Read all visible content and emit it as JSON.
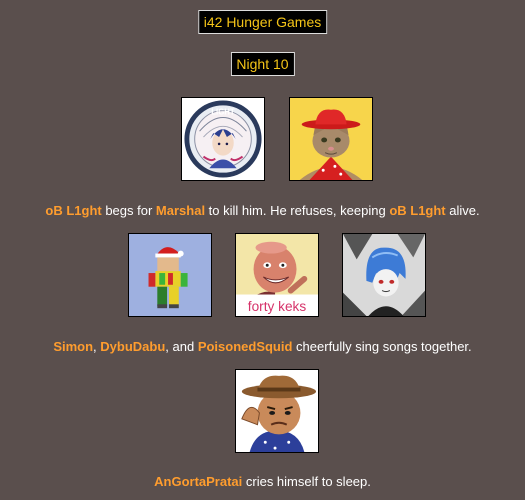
{
  "header": {
    "title": "i42 Hunger Games",
    "subtitle": "Night 10"
  },
  "colors": {
    "background": "#5a4f4d",
    "title_text": "#f5c518",
    "name_highlight": "#ff9d2e",
    "body_text": "#ffffff"
  },
  "events": [
    {
      "tributes": [
        "oB L1ght",
        "Marshal"
      ],
      "parts": [
        "oB L1ght",
        " begs for ",
        "Marshal",
        " to kill him. He refuses, keeping ",
        "oB L1ght",
        " alive."
      ]
    },
    {
      "tributes": [
        "Simon",
        "DybuDabu",
        "PoisonedSquid"
      ],
      "parts": [
        "Simon",
        ", ",
        "DybuDabu",
        ", and ",
        "PoisonedSquid",
        " cheerfully sing songs together."
      ]
    },
    {
      "tributes": [
        "AnGortaPratai"
      ],
      "parts": [
        "AnGortaPratai",
        " cries himself to sleep."
      ]
    }
  ],
  "avatars": {
    "light_logo_text": "LIGHT",
    "forty_keks_caption": "forty keks"
  }
}
